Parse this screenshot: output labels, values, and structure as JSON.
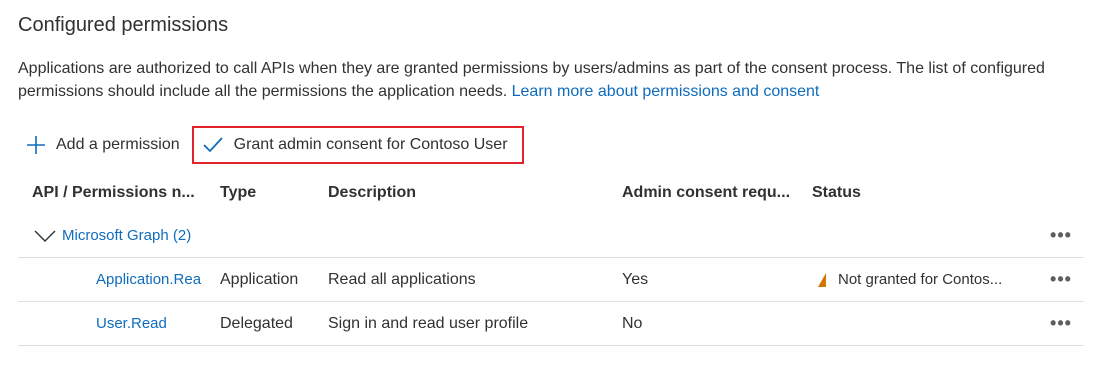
{
  "title": "Configured permissions",
  "description": {
    "text": "Applications are authorized to call APIs when they are granted permissions by users/admins as part of the consent process. The list of configured permissions should include all the permissions the application needs.",
    "link": "Learn more about permissions and consent"
  },
  "toolbar": {
    "add_label": "Add a permission",
    "grant_label": "Grant admin consent for Contoso User"
  },
  "table": {
    "headers": {
      "api": "API / Permissions n...",
      "type": "Type",
      "description": "Description",
      "admin_consent": "Admin consent requ...",
      "status": "Status"
    },
    "group": {
      "label": "Microsoft Graph (2)"
    },
    "rows": [
      {
        "api": "Application.Rea",
        "type": "Application",
        "description": "Read all applications",
        "admin_consent": "Yes",
        "status": "Not granted for Contos..."
      },
      {
        "api": "User.Read",
        "type": "Delegated",
        "description": "Sign in and read user profile",
        "admin_consent": "No",
        "status": ""
      }
    ],
    "more_label": "•••"
  },
  "colors": {
    "link": "#0f6cbd",
    "highlight": "#e3242b",
    "warning": "#d47500"
  }
}
